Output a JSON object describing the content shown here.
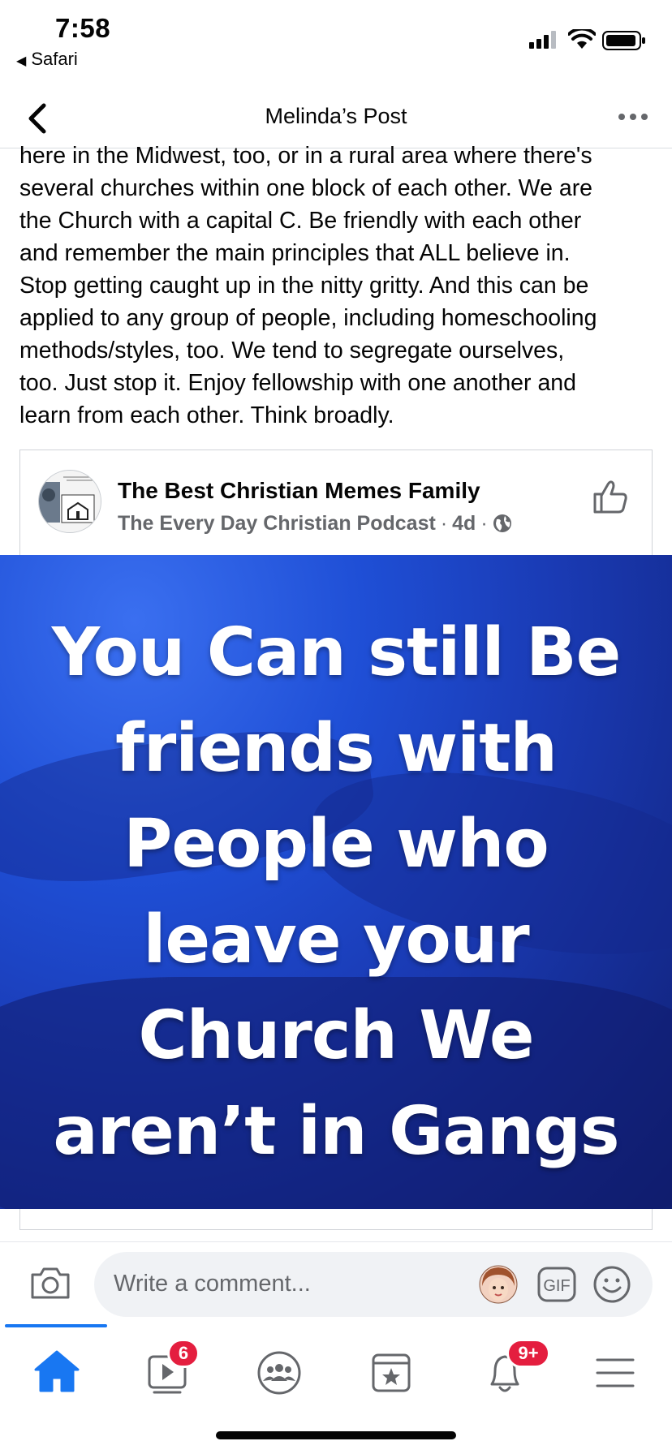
{
  "status_bar": {
    "time": "7:58",
    "back_app": "Safari"
  },
  "nav": {
    "title": "Melinda’s Post"
  },
  "post": {
    "text_lines": [
      "here in the Midwest, too, or in a rural area where there's",
      "several churches within one block of each other. We are",
      "the Church with a capital C. Be friendly with each other",
      "and remember the main principles that ALL believe in.",
      "Stop getting caught up in the nitty gritty. And this can be",
      "applied to any group of people, including homeschooling",
      "methods/styles, too. We tend to segregate ourselves,",
      "too. Just stop it.  Enjoy fellowship with one another and",
      "learn from each other. Think broadly."
    ]
  },
  "shared_card": {
    "group_name": "The Best Christian Memes Family",
    "author": "The Every Day Christian Podcast",
    "age": "4d",
    "separator": "·",
    "avatar_icon": "podcast-logo",
    "like_icon": "thumbs-up-icon"
  },
  "meme": {
    "lines": [
      "You Can still Be",
      "friends with",
      "People who",
      "leave your",
      "Church We",
      "aren’t in Gangs"
    ],
    "background_color": "#1f4fd6"
  },
  "comment_bar": {
    "placeholder": "Write a comment...",
    "gif_label": "GIF"
  },
  "tabbar": {
    "active": "home",
    "video_badge": "6",
    "notifications_badge": "9+",
    "accent_color": "#1877f2",
    "badge_color": "#e41e3f"
  }
}
